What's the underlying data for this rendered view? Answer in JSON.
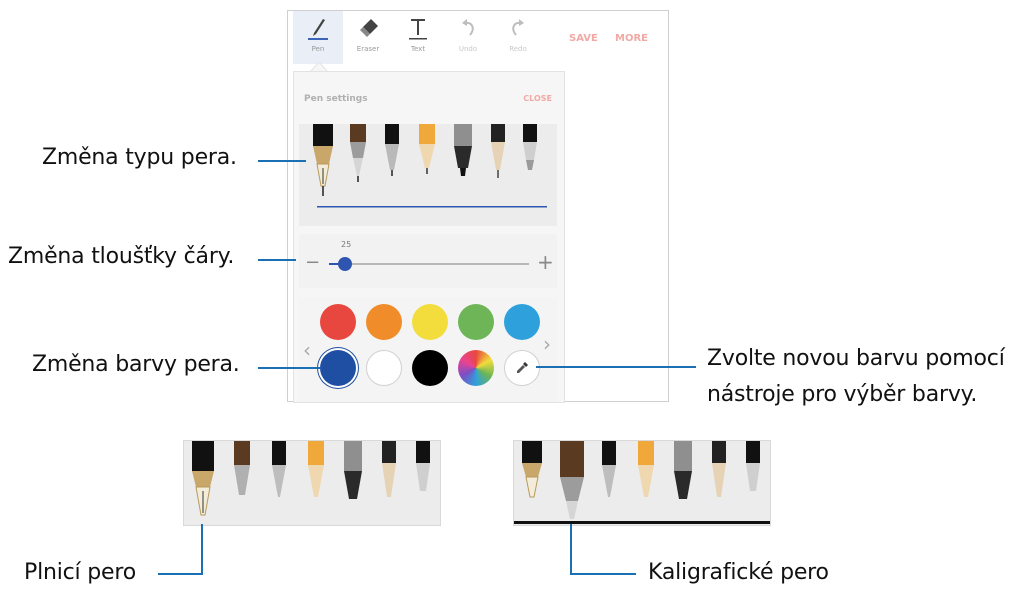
{
  "toolbar": {
    "items": [
      {
        "label": "Pen",
        "icon": "pen-icon"
      },
      {
        "label": "Eraser",
        "icon": "eraser-icon"
      },
      {
        "label": "Text",
        "icon": "text-icon"
      },
      {
        "label": "Undo",
        "icon": "undo-icon"
      },
      {
        "label": "Redo",
        "icon": "redo-icon"
      }
    ],
    "save": "SAVE",
    "more": "MORE"
  },
  "pen_settings": {
    "title": "Pen settings",
    "close": "CLOSE",
    "thickness_value": "25",
    "thickness_fraction": 0.08,
    "minus": "−",
    "plus": "+",
    "prev_arrow": "‹",
    "next_arrow": "›"
  },
  "colors": {
    "row1": [
      "#e8473f",
      "#f08c2a",
      "#f2dd3c",
      "#6db556",
      "#2ea1dc"
    ],
    "row2": [
      "#1f4fa3",
      "#ffffff",
      "#000000"
    ],
    "selected": "#1f4fa3"
  },
  "callouts": {
    "pen_type": "Změna typu pera.",
    "thickness": "Změna tloušťky čáry.",
    "color": "Změna barvy pera.",
    "picker_line1": "Zvolte novou barvu pomocí",
    "picker_line2": "nástroje pro výběr barvy.",
    "fountain": "Plnicí pero",
    "calligraphy": "Kaligrafické pero"
  },
  "accent": "#1a6fb5"
}
